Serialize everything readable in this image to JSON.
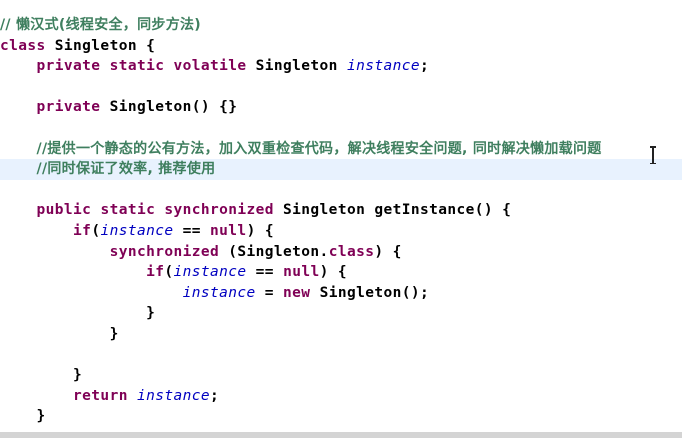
{
  "editor": {
    "lines": [
      {
        "indent": "",
        "tokens": [
          {
            "t": "comment",
            "v": "// 懒汉式(线程安全，同步方法)"
          }
        ]
      },
      {
        "indent": "",
        "tokens": [
          {
            "t": "kw",
            "v": "class"
          },
          {
            "t": "plain",
            "v": " Singleton {"
          }
        ]
      },
      {
        "indent": "    ",
        "tokens": [
          {
            "t": "kw",
            "v": "private static volatile"
          },
          {
            "t": "plain",
            "v": " Singleton "
          },
          {
            "t": "field",
            "v": "instance"
          },
          {
            "t": "plain",
            "v": ";"
          }
        ]
      },
      {
        "indent": "",
        "tokens": []
      },
      {
        "indent": "    ",
        "tokens": [
          {
            "t": "kw",
            "v": "private"
          },
          {
            "t": "plain",
            "v": " Singleton() {}"
          }
        ]
      },
      {
        "indent": "",
        "tokens": []
      },
      {
        "indent": "    ",
        "tokens": [
          {
            "t": "comment",
            "v": "//提供一个静态的公有方法，加入双重检查代码，解决线程安全问题, 同时解决懒加载问题"
          }
        ]
      },
      {
        "indent": "    ",
        "current": true,
        "tokens": [
          {
            "t": "comment",
            "v": "//同时保证了效率, 推荐使用"
          }
        ]
      },
      {
        "indent": "",
        "tokens": []
      },
      {
        "indent": "    ",
        "tokens": [
          {
            "t": "kw",
            "v": "public static synchronized"
          },
          {
            "t": "plain",
            "v": " Singleton getInstance() {"
          }
        ]
      },
      {
        "indent": "        ",
        "tokens": [
          {
            "t": "kw",
            "v": "if"
          },
          {
            "t": "plain",
            "v": "("
          },
          {
            "t": "field",
            "v": "instance"
          },
          {
            "t": "plain",
            "v": " == "
          },
          {
            "t": "kw",
            "v": "null"
          },
          {
            "t": "plain",
            "v": ") {"
          }
        ]
      },
      {
        "indent": "            ",
        "tokens": [
          {
            "t": "kw",
            "v": "synchronized"
          },
          {
            "t": "plain",
            "v": " (Singleton."
          },
          {
            "t": "kw",
            "v": "class"
          },
          {
            "t": "plain",
            "v": ") {"
          }
        ]
      },
      {
        "indent": "                ",
        "tokens": [
          {
            "t": "kw",
            "v": "if"
          },
          {
            "t": "plain",
            "v": "("
          },
          {
            "t": "field",
            "v": "instance"
          },
          {
            "t": "plain",
            "v": " == "
          },
          {
            "t": "kw",
            "v": "null"
          },
          {
            "t": "plain",
            "v": ") {"
          }
        ]
      },
      {
        "indent": "                    ",
        "tokens": [
          {
            "t": "field",
            "v": "instance"
          },
          {
            "t": "plain",
            "v": " = "
          },
          {
            "t": "kw",
            "v": "new"
          },
          {
            "t": "plain",
            "v": " Singleton();"
          }
        ]
      },
      {
        "indent": "                ",
        "tokens": [
          {
            "t": "plain",
            "v": "}"
          }
        ]
      },
      {
        "indent": "            ",
        "tokens": [
          {
            "t": "plain",
            "v": "}"
          }
        ]
      },
      {
        "indent": "",
        "tokens": []
      },
      {
        "indent": "        ",
        "tokens": [
          {
            "t": "plain",
            "v": "}"
          }
        ]
      },
      {
        "indent": "        ",
        "tokens": [
          {
            "t": "kw",
            "v": "return"
          },
          {
            "t": "plain",
            "v": " "
          },
          {
            "t": "field",
            "v": "instance"
          },
          {
            "t": "plain",
            "v": ";"
          }
        ]
      },
      {
        "indent": "    ",
        "tokens": [
          {
            "t": "plain",
            "v": "}"
          }
        ]
      }
    ]
  },
  "colors": {
    "keyword": "#7f0055",
    "comment": "#3f7f5f",
    "field": "#0000c0",
    "current_line": "#e8f2fe",
    "text": "#000000"
  },
  "cursor": {
    "icon": "text-cursor-icon"
  }
}
